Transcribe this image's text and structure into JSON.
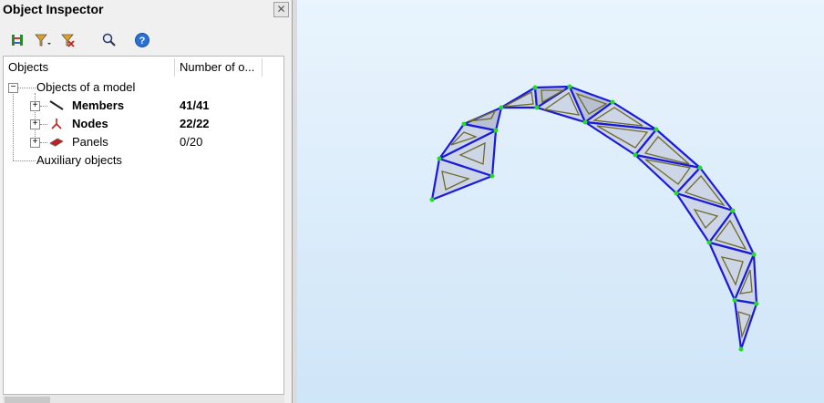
{
  "inspector": {
    "title": "Object Inspector",
    "close_icon": "close-icon",
    "toolbar": [
      {
        "name": "model-icon"
      },
      {
        "name": "filter-dropdown-icon"
      },
      {
        "name": "filter-clear-icon"
      },
      {
        "name": "find-icon"
      },
      {
        "name": "help-icon"
      }
    ],
    "columns": {
      "objects": "Objects",
      "number": "Number of o..."
    },
    "tree": {
      "root": "Objects of a model",
      "members": {
        "label": "Members",
        "count": "41/41"
      },
      "nodes": {
        "label": "Nodes",
        "count": "22/22"
      },
      "panels": {
        "label": "Panels",
        "count": "0/20"
      },
      "auxiliary": "Auxiliary objects"
    }
  },
  "colors": {
    "member_line": "#1a1adc",
    "node": "#22dd22",
    "panel_fill": "#cdd6e6",
    "panel_fill_dark": "#b4bdd0",
    "load_triangle": "#6e6a2a"
  }
}
